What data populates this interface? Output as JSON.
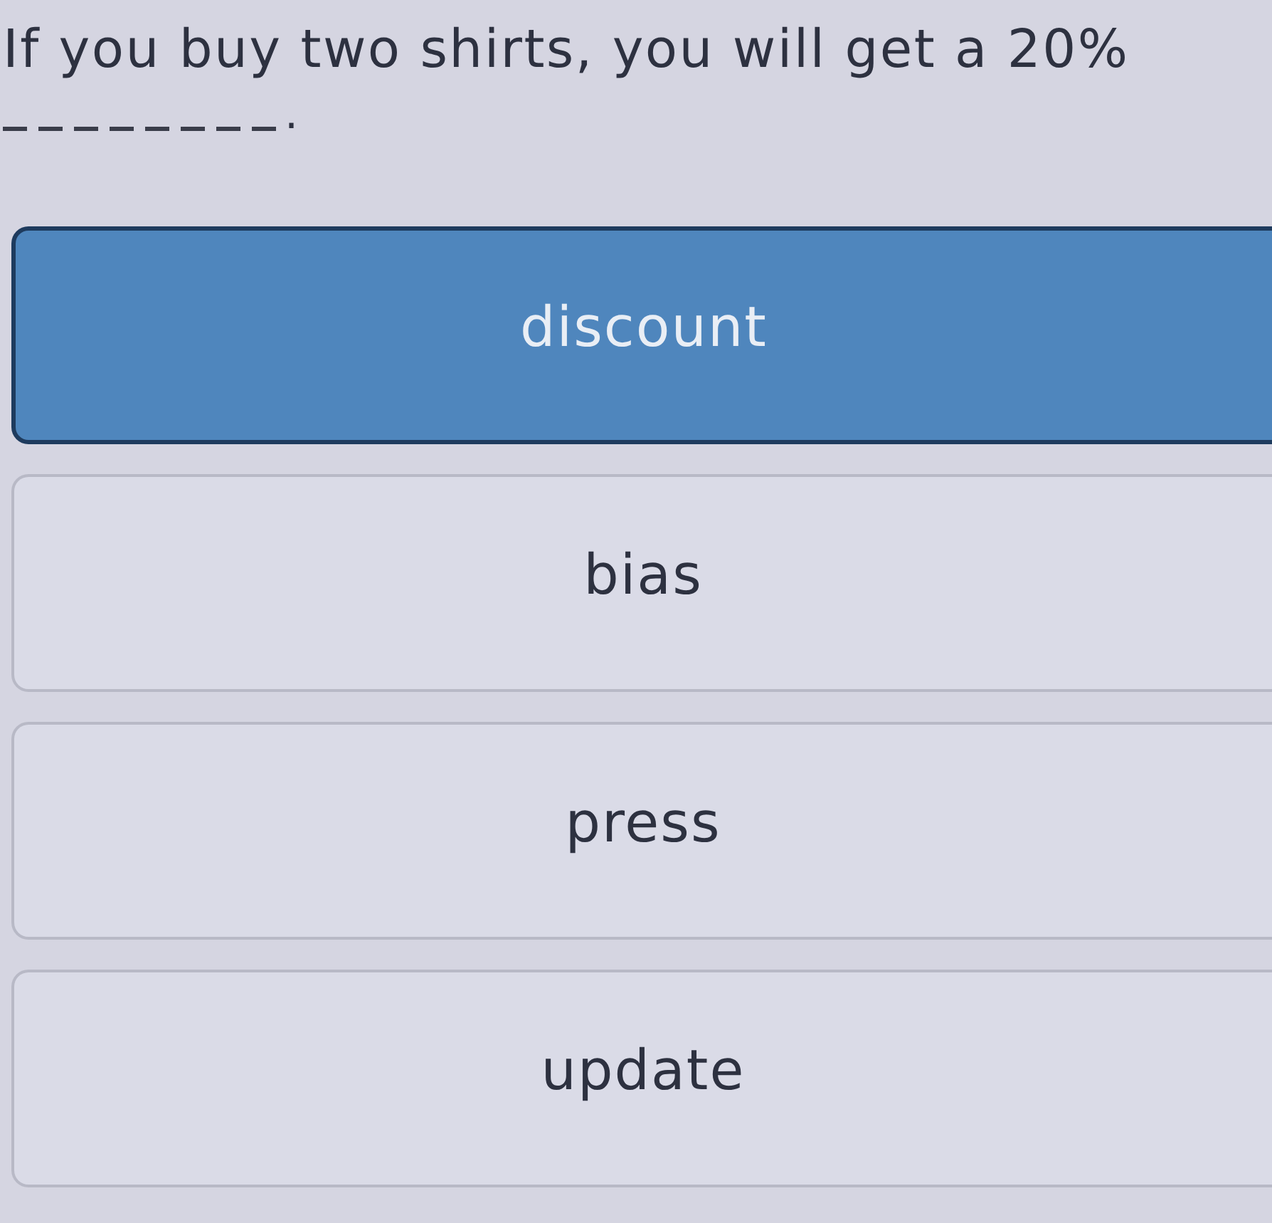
{
  "question": {
    "text": "If you buy two shirts, you will get a 20%",
    "punctuation": "."
  },
  "options": [
    {
      "label": "discount",
      "selected": true
    },
    {
      "label": "bias",
      "selected": false
    },
    {
      "label": "press",
      "selected": false
    },
    {
      "label": "update",
      "selected": false
    }
  ]
}
